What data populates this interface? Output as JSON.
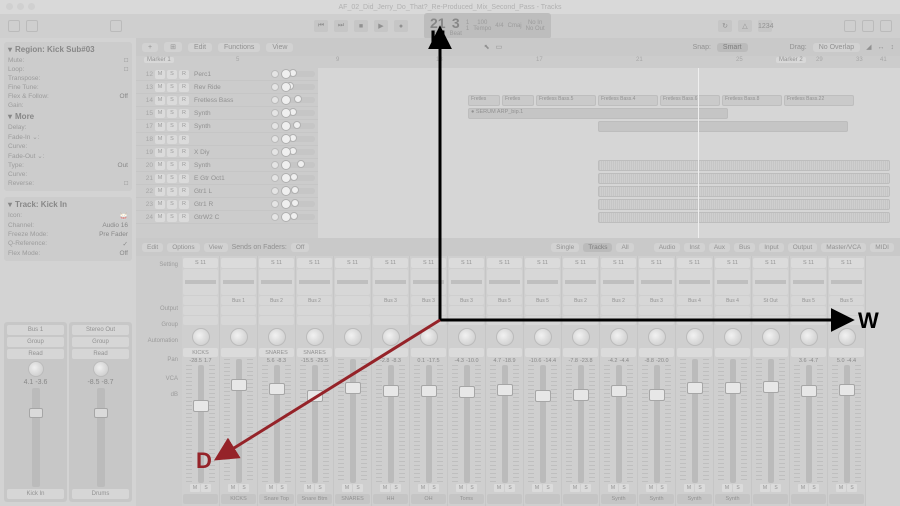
{
  "titlebar": {
    "title": "AF_02_Did_Jerry_Do_That?_Re-Produced_Mix_Second_Pass - Tracks"
  },
  "transport": {
    "bars": "21",
    "beats": "3",
    "div": "1",
    "ticks": "1",
    "bar_label": "Bar",
    "tempo": "100",
    "sig": "4/4",
    "key": "Cmaj",
    "no_in": "No In",
    "no_out": "No Out"
  },
  "regionInspector": {
    "title": "Region: Kick Sub#03",
    "rows": [
      {
        "lbl": "Mute:",
        "val": "□"
      },
      {
        "lbl": "Loop:",
        "val": "□"
      },
      {
        "lbl": "Transpose:",
        "val": ""
      },
      {
        "lbl": "Fine Tune:",
        "val": ""
      },
      {
        "lbl": "Flex & Follow:",
        "val": "Off"
      },
      {
        "lbl": "Gain:",
        "val": ""
      }
    ],
    "more": "More",
    "moreRows": [
      {
        "lbl": "Delay:",
        "val": ""
      },
      {
        "lbl": "Fade-In ⌄:",
        "val": ""
      },
      {
        "lbl": "Curve:",
        "val": ""
      },
      {
        "lbl": "Fade-Out ⌄:",
        "val": ""
      },
      {
        "lbl": "Type:",
        "val": "Out"
      },
      {
        "lbl": "Curve:",
        "val": ""
      },
      {
        "lbl": "Reverse:",
        "val": "□"
      }
    ]
  },
  "trackInspector": {
    "title": "Track: Kick In",
    "rows": [
      {
        "lbl": "Icon:",
        "val": "🥁"
      },
      {
        "lbl": "Channel:",
        "val": "Audio 16"
      },
      {
        "lbl": "Freeze Mode:",
        "val": "Pre Fader"
      },
      {
        "lbl": "Q-Reference:",
        "val": "✓"
      },
      {
        "lbl": "Flex Mode:",
        "val": "Off"
      }
    ],
    "strips": [
      {
        "slot": "Bus 1",
        "group": "Group",
        "read": "Read",
        "gain": "4.1",
        "pan": "-3.6",
        "name": "Kick In"
      },
      {
        "slot": "Stereo Out",
        "group": "Group",
        "read": "Read",
        "gain": "-8.5",
        "pan": "-8.7",
        "name": "Drums"
      }
    ]
  },
  "trackToolbar": {
    "edit": "Edit",
    "functions": "Functions",
    "view": "View",
    "snap_lbl": "Snap:",
    "snap_val": "Smart",
    "drag_lbl": "Drag:",
    "drag_val": "No Overlap"
  },
  "ruler": {
    "marker1": "Marker 1",
    "marker2": "Marker 2"
  },
  "tracks": [
    {
      "num": "12",
      "name": "Perc1",
      "slider": 0.3
    },
    {
      "num": "13",
      "name": "Rev Ride",
      "slider": 0.2
    },
    {
      "num": "14",
      "name": "Fretless Bass",
      "slider": 0.5
    },
    {
      "num": "15",
      "name": "Synth",
      "slider": 0.3
    },
    {
      "num": "17",
      "name": "Synth",
      "slider": 0.45
    },
    {
      "num": "18",
      "name": "",
      "slider": 0.3
    },
    {
      "num": "19",
      "name": "X Diy",
      "slider": 0.3
    },
    {
      "num": "20",
      "name": "Synth",
      "slider": 0.6
    },
    {
      "num": "21",
      "name": "E Gtr Oct1",
      "slider": 0.35
    },
    {
      "num": "22",
      "name": "Gtr1 L",
      "slider": 0.4
    },
    {
      "num": "23",
      "name": "Gtr1 R",
      "slider": 0.4
    },
    {
      "num": "24",
      "name": "GtrW2 C",
      "slider": 0.35
    }
  ],
  "regions": {
    "bass_labels": [
      "Fretles",
      "Fretles",
      "Fretless Bass.5",
      "Fretless Bass.4",
      "Fretless Bass.6",
      "Fretless Bass.8",
      "Fretless Bass.22"
    ],
    "serum": "● SERUM ARP_bip.1"
  },
  "mixerToolbar": {
    "edit": "Edit",
    "options": "Options",
    "view": "View",
    "sof_lbl": "Sends on Faders:",
    "sof_val": "Off",
    "single": "Single",
    "tracks": "Tracks",
    "all": "All",
    "filters": [
      "Audio",
      "Inst",
      "Aux",
      "Bus",
      "Input",
      "Output",
      "Master/VCA",
      "MIDI"
    ]
  },
  "mixerLegend": {
    "setting": "Setting",
    "output": "Output",
    "group": "Group",
    "automation": "Automation",
    "pan": "Pan",
    "vca": "VCA",
    "db": "dB"
  },
  "strips": [
    {
      "tag": "S 11",
      "bus": "",
      "vca": "KICKS",
      "g": "-28.5",
      "p": "1.7",
      "cap": 0.7,
      "name": ""
    },
    {
      "tag": "",
      "bus": "Bus 1",
      "vca": "",
      "g": "",
      "p": "",
      "cap": 0.4,
      "name": "KICKS"
    },
    {
      "tag": "S 11",
      "bus": "Bus 2",
      "vca": "SNARES",
      "g": "5.6",
      "p": "-8.3",
      "cap": 0.35,
      "name": "Snare Top"
    },
    {
      "tag": "S 11",
      "bus": "Bus 2",
      "vca": "SNARES",
      "g": "-15.5",
      "p": "-25.5",
      "cap": 0.5,
      "name": "Snare Btm"
    },
    {
      "tag": "S 11",
      "bus": "",
      "vca": "",
      "g": "",
      "p": "",
      "cap": 0.45,
      "name": "SNARES"
    },
    {
      "tag": "S 11",
      "bus": "Bus 3",
      "vca": "",
      "g": "-2.8",
      "p": "-8.3",
      "cap": 0.4,
      "name": "HH"
    },
    {
      "tag": "S 11",
      "bus": "Bus 3",
      "vca": "",
      "g": "0.1",
      "p": "-17.5",
      "cap": 0.4,
      "name": "OH"
    },
    {
      "tag": "S 11",
      "bus": "Bus 3",
      "vca": "",
      "g": "-4.3",
      "p": "-10.0",
      "cap": 0.42,
      "name": "Toms"
    },
    {
      "tag": "S 11",
      "bus": "Bus 5",
      "vca": "",
      "g": "4.7",
      "p": "-18.9",
      "cap": 0.38,
      "name": ""
    },
    {
      "tag": "S 11",
      "bus": "Bus 5",
      "vca": "",
      "g": "-10.6",
      "p": "-14.4",
      "cap": 0.5,
      "name": ""
    },
    {
      "tag": "S 11",
      "bus": "Bus 2",
      "vca": "",
      "g": "-7.8",
      "p": "-23.8",
      "cap": 0.48,
      "name": ""
    },
    {
      "tag": "S 11",
      "bus": "Bus 2",
      "vca": "",
      "g": "-4.2",
      "p": "-4.4",
      "cap": 0.4,
      "name": "Synth"
    },
    {
      "tag": "S 11",
      "bus": "Bus 3",
      "vca": "",
      "g": "-8.8",
      "p": "-20.0",
      "cap": 0.47,
      "name": "Synth"
    },
    {
      "tag": "S 11",
      "bus": "Bus 4",
      "vca": "",
      "g": "",
      "p": "",
      "cap": 0.45,
      "name": "Synth"
    },
    {
      "tag": "S 11",
      "bus": "Bus 4",
      "vca": "",
      "g": "",
      "p": "",
      "cap": 0.45,
      "name": "Synth"
    },
    {
      "tag": "S 11",
      "bus": "St Out",
      "vca": "",
      "g": "",
      "p": "",
      "cap": 0.43,
      "name": ""
    },
    {
      "tag": "S 11",
      "bus": "Bus 5",
      "vca": "",
      "g": "3.6",
      "p": "-4.7",
      "cap": 0.4,
      "name": ""
    },
    {
      "tag": "S 11",
      "bus": "Bus 5",
      "vca": "",
      "g": "5.0",
      "p": "-4.4",
      "cap": 0.38,
      "name": ""
    }
  ],
  "arrows": {
    "H": "H",
    "W": "W",
    "D": "D"
  }
}
